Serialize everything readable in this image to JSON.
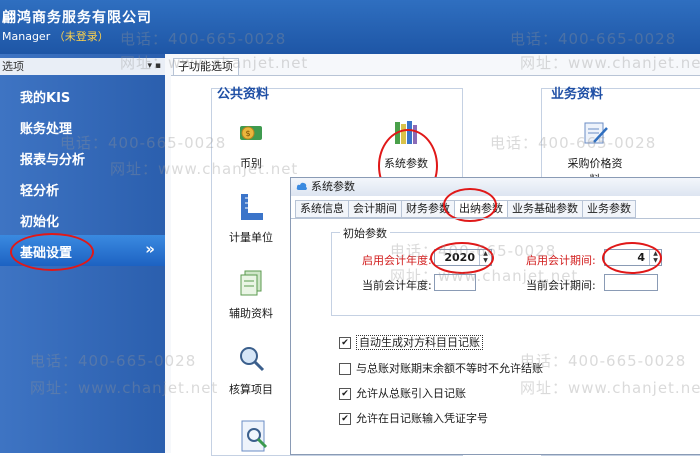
{
  "app": {
    "title": "翩鸿商务服务有限公司",
    "subtitle": "Manager",
    "login_status": "（未登录）"
  },
  "watermarks": {
    "phone": "电话：400-665-0028",
    "site": "网址：www.chanjet.net"
  },
  "sidebar": {
    "header": "选项",
    "items": [
      {
        "label": "我的KIS"
      },
      {
        "label": "账务处理"
      },
      {
        "label": "报表与分析"
      },
      {
        "label": "轻分析"
      },
      {
        "label": "初始化"
      },
      {
        "label": "基础设置",
        "chevron": "»"
      }
    ]
  },
  "main": {
    "tab_label": "子功能选项",
    "public_section": "公共资料",
    "business_section": "业务资料",
    "tiles": [
      {
        "label": "币别",
        "icon": "coin-icon"
      },
      {
        "label": "系统参数",
        "icon": "books-icon"
      },
      {
        "label": "采购价格资料",
        "icon": "document-pen-icon"
      },
      {
        "label": "计量单位",
        "icon": "ruler-icon"
      },
      {
        "label": "辅助资料",
        "icon": "stacked-docs-icon"
      },
      {
        "label": "核算项目",
        "icon": "magnifier-icon"
      }
    ]
  },
  "dialog": {
    "title": "系统参数",
    "tabs": [
      "系统信息",
      "会计期间",
      "财务参数",
      "出纳参数",
      "业务基础参数",
      "业务参数"
    ],
    "active_tab": "出纳参数",
    "group_title": "初始参数",
    "start_year_label": "启用会计年度:",
    "start_year_value": "2020",
    "start_period_label": "启用会计期间:",
    "start_period_value": "4",
    "current_year_label": "当前会计年度:",
    "current_period_label": "当前会计期间:",
    "options": [
      {
        "label": "自动生成对方科目日记账",
        "checked": true
      },
      {
        "label": "与总账对账期末余额不等时不允许结账",
        "checked": false
      },
      {
        "label": "允许从总账引入日记账",
        "checked": true
      },
      {
        "label": "允许在日记账输入凭证字号",
        "checked": true
      }
    ]
  },
  "colors": {
    "accent": "#1e56a6",
    "highlight": "#e01818",
    "required": "#d11b1b"
  }
}
